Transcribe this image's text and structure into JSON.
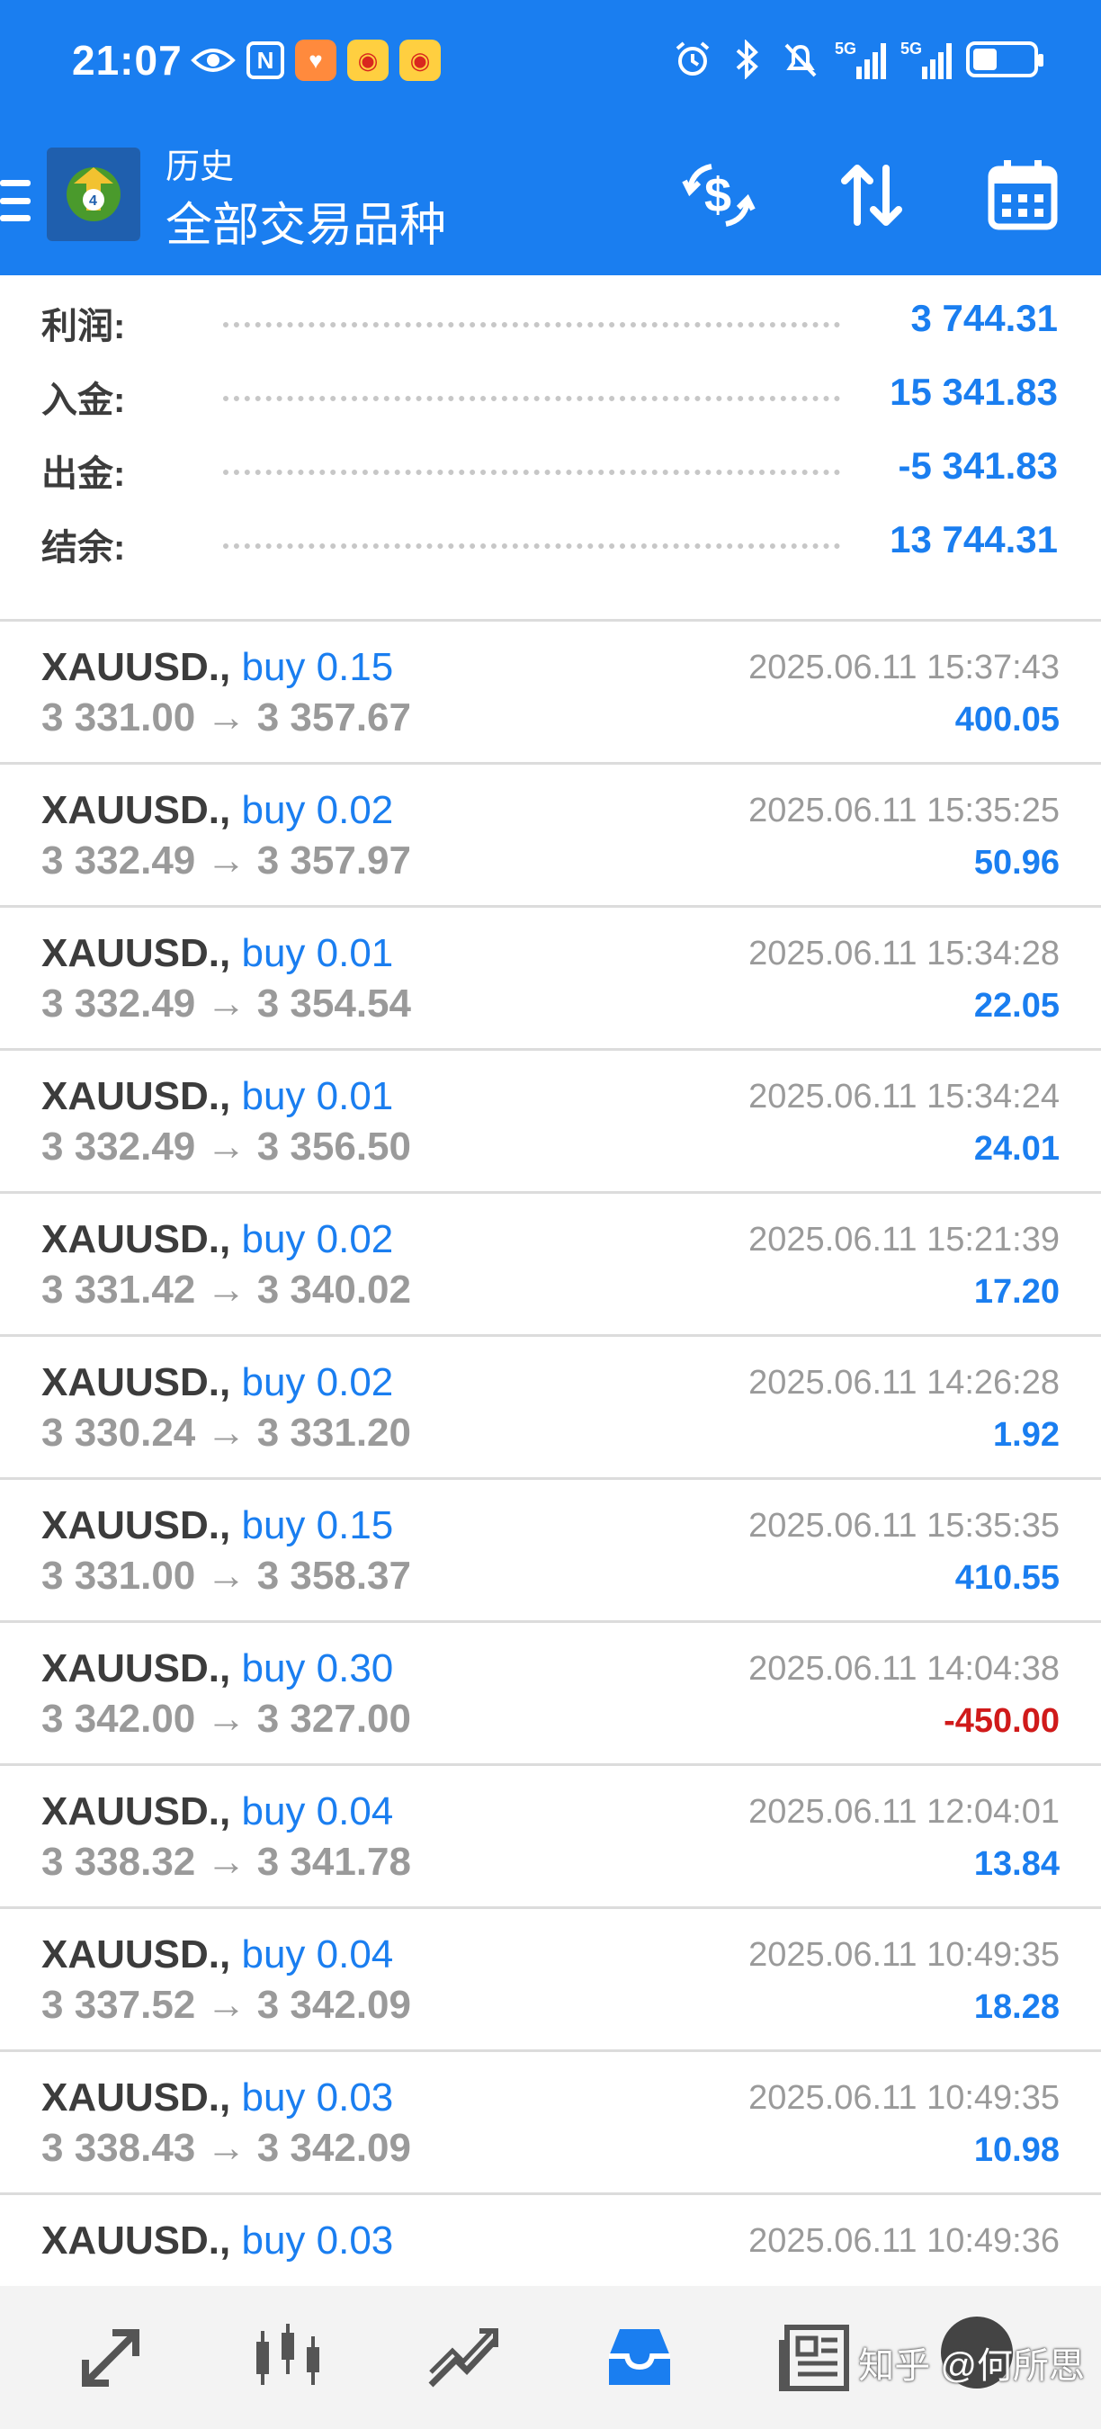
{
  "status_bar": {
    "time": "21:07",
    "nfc_glyph": "N",
    "signal_label_1": "5G",
    "signal_label_2": "5G"
  },
  "header": {
    "title_small": "历史",
    "title_big": "全部交易品种",
    "accent_color": "#1a7ef0"
  },
  "summary": [
    {
      "label": "利润:",
      "value": "3 744.31"
    },
    {
      "label": "入金:",
      "value": "15 341.83"
    },
    {
      "label": "出金:",
      "value": "-5 341.83"
    },
    {
      "label": "结余:",
      "value": "13 744.31"
    }
  ],
  "trades": [
    {
      "symbol": "XAUUSD.,",
      "side": " buy 0.15",
      "prices": "3 331.00 → 3 357.67",
      "time": "2025.06.11 15:37:43",
      "profit": "400.05",
      "negative": false
    },
    {
      "symbol": "XAUUSD.,",
      "side": " buy 0.02",
      "prices": "3 332.49 → 3 357.97",
      "time": "2025.06.11 15:35:25",
      "profit": "50.96",
      "negative": false
    },
    {
      "symbol": "XAUUSD.,",
      "side": " buy 0.01",
      "prices": "3 332.49 → 3 354.54",
      "time": "2025.06.11 15:34:28",
      "profit": "22.05",
      "negative": false
    },
    {
      "symbol": "XAUUSD.,",
      "side": " buy 0.01",
      "prices": "3 332.49 → 3 356.50",
      "time": "2025.06.11 15:34:24",
      "profit": "24.01",
      "negative": false
    },
    {
      "symbol": "XAUUSD.,",
      "side": " buy 0.02",
      "prices": "3 331.42 → 3 340.02",
      "time": "2025.06.11 15:21:39",
      "profit": "17.20",
      "negative": false
    },
    {
      "symbol": "XAUUSD.,",
      "side": " buy 0.02",
      "prices": "3 330.24 → 3 331.20",
      "time": "2025.06.11 14:26:28",
      "profit": "1.92",
      "negative": false
    },
    {
      "symbol": "XAUUSD.,",
      "side": " buy 0.15",
      "prices": "3 331.00 → 3 358.37",
      "time": "2025.06.11 15:35:35",
      "profit": "410.55",
      "negative": false
    },
    {
      "symbol": "XAUUSD.,",
      "side": " buy 0.30",
      "prices": "3 342.00 → 3 327.00",
      "time": "2025.06.11 14:04:38",
      "profit": "-450.00",
      "negative": true
    },
    {
      "symbol": "XAUUSD.,",
      "side": " buy 0.04",
      "prices": "3 338.32 → 3 341.78",
      "time": "2025.06.11 12:04:01",
      "profit": "13.84",
      "negative": false
    },
    {
      "symbol": "XAUUSD.,",
      "side": " buy 0.04",
      "prices": "3 337.52 → 3 342.09",
      "time": "2025.06.11 10:49:35",
      "profit": "18.28",
      "negative": false
    },
    {
      "symbol": "XAUUSD.,",
      "side": " buy 0.03",
      "prices": "3 338.43 → 3 342.09",
      "time": "2025.06.11 10:49:35",
      "profit": "10.98",
      "negative": false
    },
    {
      "symbol": "XAUUSD.,",
      "side": " buy 0.03",
      "prices": "",
      "time": "2025.06.11 10:49:36",
      "profit": "",
      "negative": false
    }
  ],
  "bottom_nav": {
    "items": [
      "quotes-icon",
      "chart-icon",
      "trade-icon",
      "history-icon",
      "news-icon",
      "settings-icon"
    ],
    "active": "history-icon",
    "watermark": "知乎 @何所思"
  }
}
